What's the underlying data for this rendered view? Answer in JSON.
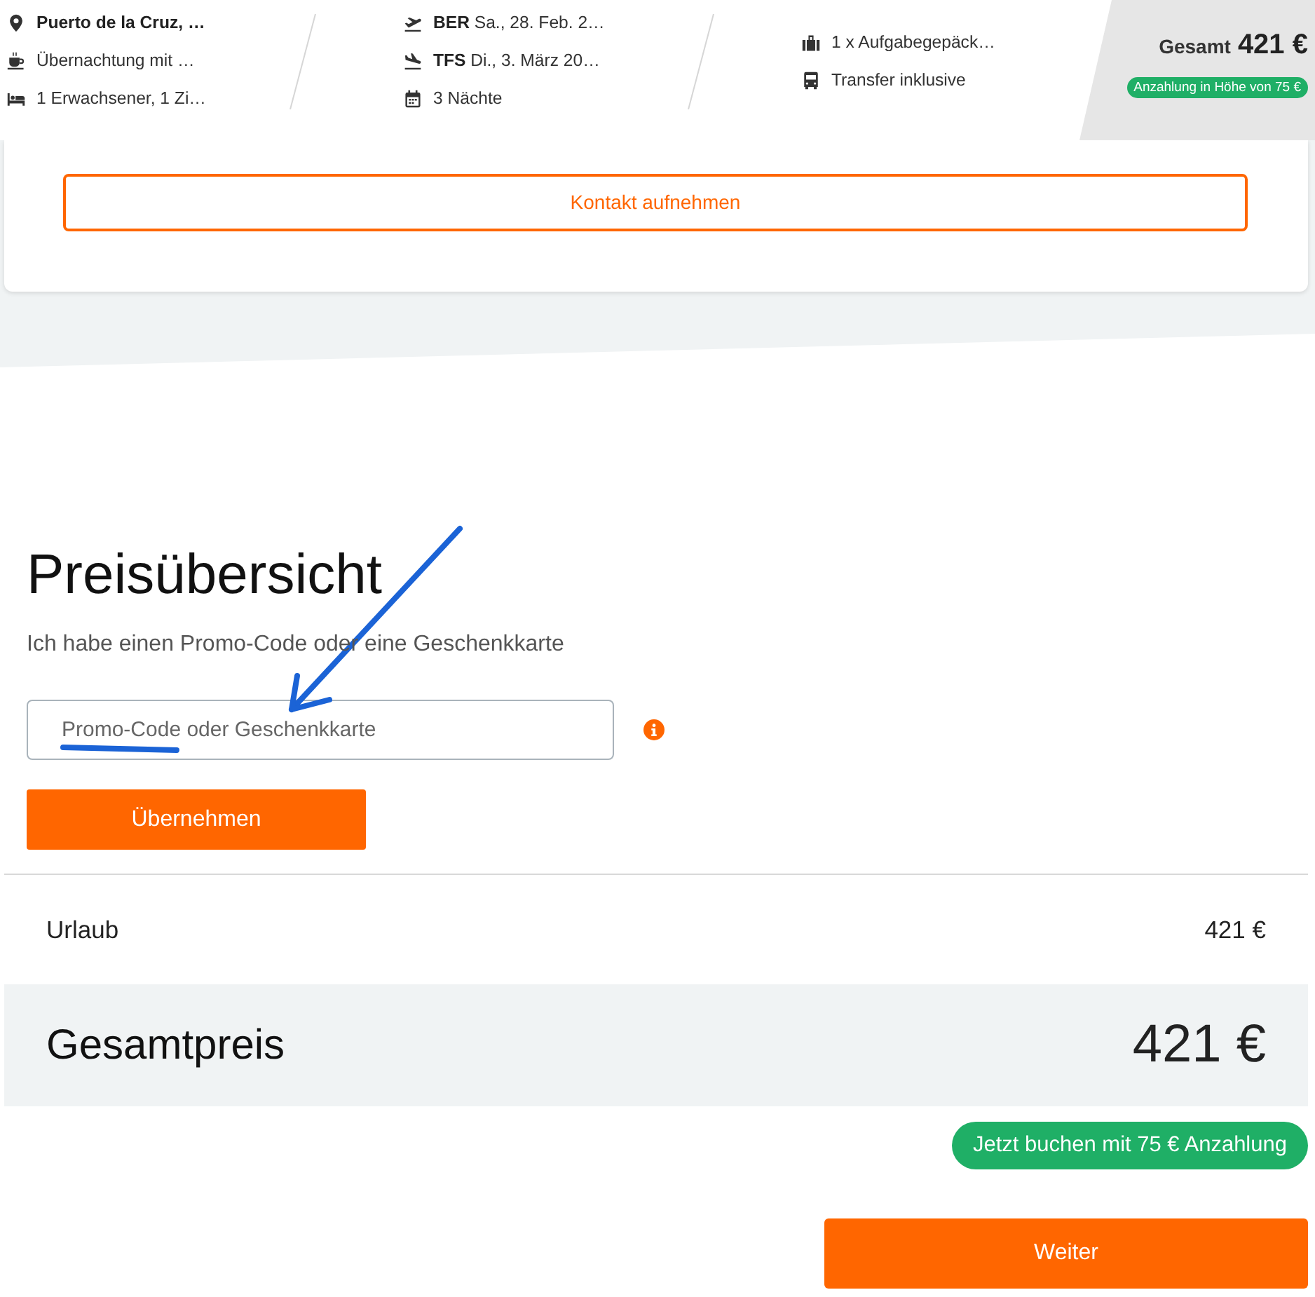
{
  "summary_bar": {
    "columns": [
      {
        "items": [
          {
            "kind": "location",
            "text": "Puerto de la Cruz, …"
          },
          {
            "kind": "meal",
            "text": "Übernachtung mit …"
          },
          {
            "kind": "room",
            "text": "1 Erwachsener, 1 Zi…"
          }
        ]
      },
      {
        "items": [
          {
            "kind": "outbound",
            "text": "**BER** Sa., 28. Feb. 2…"
          },
          {
            "kind": "return",
            "text": "**TFS** Di., 3. März 20…"
          },
          {
            "kind": "duration",
            "text": "3 Nächte"
          }
        ]
      },
      {
        "items": [
          {
            "kind": "baggage",
            "text": "1 x Aufgabegepäck…"
          },
          {
            "kind": "transfer",
            "text": "Transfer inklusive"
          }
        ]
      }
    ],
    "total": {
      "label": "Gesamt",
      "amount": "421 €",
      "deposit_badge": "Anzahlung in Höhe von 75 €"
    }
  },
  "contact_button": "Kontakt aufnehmen",
  "price_overview": {
    "title": "Preisübersicht",
    "promo_prompt": "Ich habe einen Promo-Code oder eine Geschenkkarte",
    "promo_field": {
      "placeholder": "Promo-Code oder Geschenkkarte"
    },
    "apply_button": "Übernehmen",
    "lines": [
      {
        "label": "Urlaub",
        "amount": "421 €"
      }
    ],
    "total": {
      "label": "Gesamtpreis",
      "amount": "421 €"
    },
    "deposit_button": "Jetzt buchen mit 75 € Anzahlung",
    "next_button": "Weiter"
  },
  "annotations": {
    "arrow_to_field": true,
    "underline_in_field": true
  }
}
